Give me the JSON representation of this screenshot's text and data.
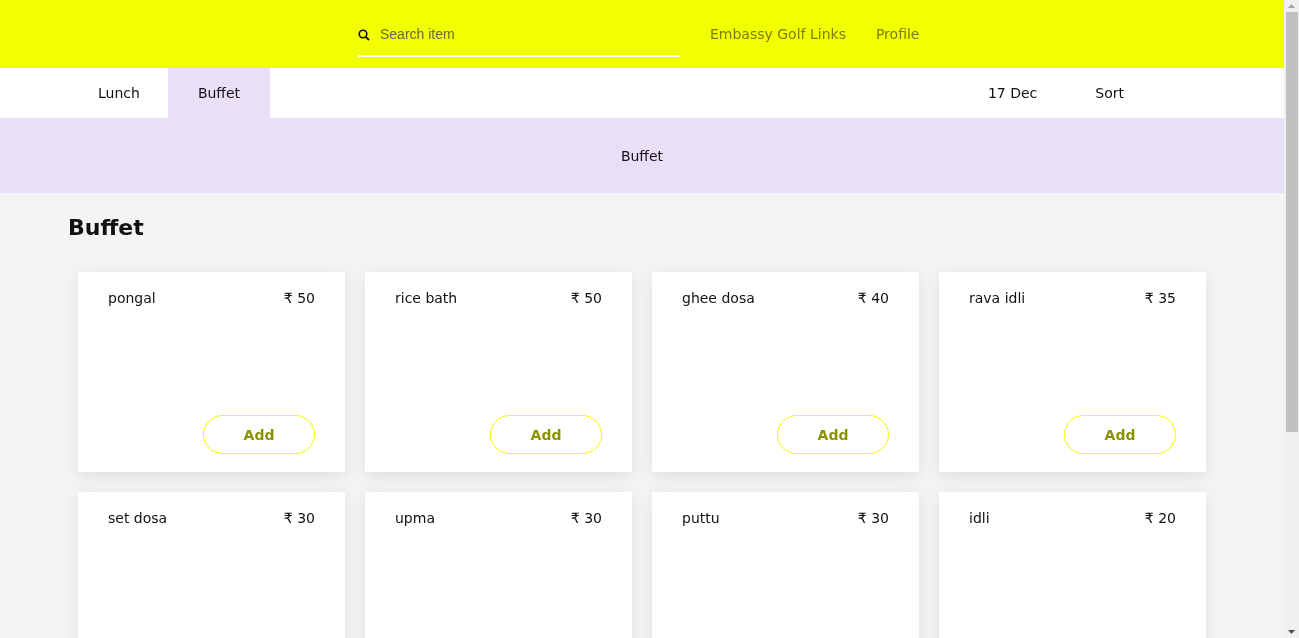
{
  "header": {
    "search": {
      "placeholder": "Search item"
    },
    "location": "Embassy Golf Links",
    "profile": "Profile"
  },
  "tabs": [
    {
      "label": "Lunch",
      "selected": false
    },
    {
      "label": "Buffet",
      "selected": true
    }
  ],
  "date": "17 Dec",
  "sort": "Sort",
  "banner": "Buffet",
  "section_title": "Buffet",
  "items": [
    {
      "name": "pongal",
      "price": "₹ 50",
      "button": "Add"
    },
    {
      "name": "rice bath",
      "price": "₹ 50",
      "button": "Add"
    },
    {
      "name": "ghee dosa",
      "price": "₹ 40",
      "button": "Add"
    },
    {
      "name": "rava idli",
      "price": "₹ 35",
      "button": "Add"
    },
    {
      "name": "set dosa",
      "price": "₹ 30"
    },
    {
      "name": "upma",
      "price": "₹ 30"
    },
    {
      "name": "puttu",
      "price": "₹ 30"
    },
    {
      "name": "idli",
      "price": "₹ 20"
    }
  ]
}
